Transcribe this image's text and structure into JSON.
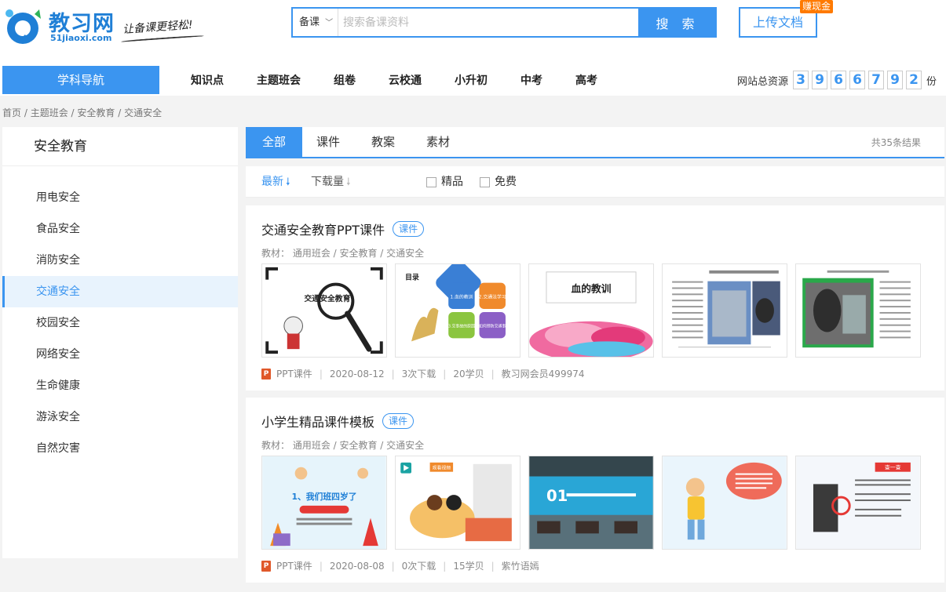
{
  "header": {
    "logo_name": "教习网",
    "logo_domain": "51jiaoxi.com",
    "slogan": "让备课更轻松!",
    "search_type": "备课",
    "search_placeholder": "搜索备课资料",
    "search_button": "搜 索",
    "upload_label": "上传文档",
    "earn_badge": "赚现金"
  },
  "nav": {
    "subject_nav": "学科导航",
    "items": [
      "知识点",
      "主题班会",
      "组卷",
      "云校通",
      "小升初",
      "中考",
      "高考"
    ],
    "counter_label": "网站总资源",
    "counter_digits": [
      "3",
      "9",
      "6",
      "6",
      "7",
      "9",
      "2"
    ],
    "counter_unit": "份"
  },
  "breadcrumb": [
    "首页",
    "主题班会",
    "安全教育",
    "交通安全"
  ],
  "sidebar": {
    "title": "安全教育",
    "items": [
      "用电安全",
      "食品安全",
      "消防安全",
      "交通安全",
      "校园安全",
      "网络安全",
      "生命健康",
      "游泳安全",
      "自然灾害"
    ],
    "active_index": 3
  },
  "tabs": {
    "items": [
      "全部",
      "课件",
      "教案",
      "素材"
    ],
    "active_index": 0,
    "result_count": "共35条结果"
  },
  "filters": {
    "sort_latest": "最新",
    "sort_downloads": "下载量",
    "check_premium": "精品",
    "check_free": "免费"
  },
  "results": [
    {
      "title": "交通安全教育PPT课件",
      "tag": "课件",
      "meta": "教材： 通用班会 / 安全教育 / 交通安全",
      "thumb_texts": [
        "交通安全教育",
        "目录",
        "血的教训",
        "",
        ""
      ],
      "toc": [
        "1.血的教训",
        "2.交通法学习",
        "3.交事故的原因",
        "4.如何预防交通事故"
      ],
      "file_type": "PPT课件",
      "date": "2020-08-12",
      "downloads": "3次下载",
      "price": "20学贝",
      "author": "教习网会员499974"
    },
    {
      "title": "小学生精品课件模板",
      "tag": "课件",
      "meta": "教材： 通用班会 / 安全教育 / 交通安全",
      "thumb_texts": [
        "1、我们班四岁了",
        "观看视频",
        "01",
        "",
        "查一查"
      ],
      "file_type": "PPT课件",
      "date": "2020-08-08",
      "downloads": "0次下载",
      "price": "15学贝",
      "author": "紫竹语嫣"
    }
  ],
  "colors": {
    "accent": "#3b95f0",
    "badge": "#ff7a00",
    "ppt": "#e0582a"
  }
}
